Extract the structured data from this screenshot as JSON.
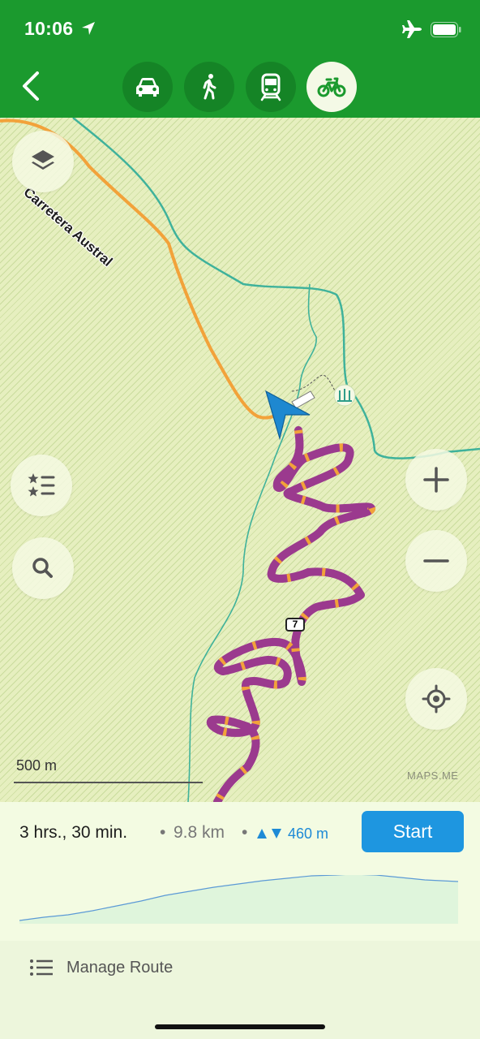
{
  "status_bar": {
    "time": "10:06",
    "location_icon": "location-arrow-icon",
    "airplane_icon": "airplane-icon",
    "battery_icon": "battery-icon"
  },
  "nav": {
    "back_icon": "chevron-left-icon",
    "modes": [
      {
        "name": "car",
        "icon": "car-icon",
        "active": false
      },
      {
        "name": "walk",
        "icon": "pedestrian-icon",
        "active": false
      },
      {
        "name": "transit",
        "icon": "train-icon",
        "active": false
      },
      {
        "name": "bike",
        "icon": "bicycle-icon",
        "active": true
      }
    ]
  },
  "map": {
    "road_label": "Carretera Austral",
    "route_shield": "7",
    "scale_label": "500 m",
    "watermark": "MAPS.ME",
    "colors": {
      "route": "#9b3a8e",
      "route_dash": "#f2a23a",
      "road": "#f2a23a",
      "river": "#3fb29b",
      "arrow": "#1e88d0"
    }
  },
  "route": {
    "time": "3 hrs., 30 min.",
    "separator": "•",
    "distance": "9.8 km",
    "elevation": "460 m",
    "start_label": "Start",
    "elevation_icon": "ascent-descent-icon"
  },
  "manage": {
    "label": "Manage Route",
    "icon": "list-icon"
  }
}
